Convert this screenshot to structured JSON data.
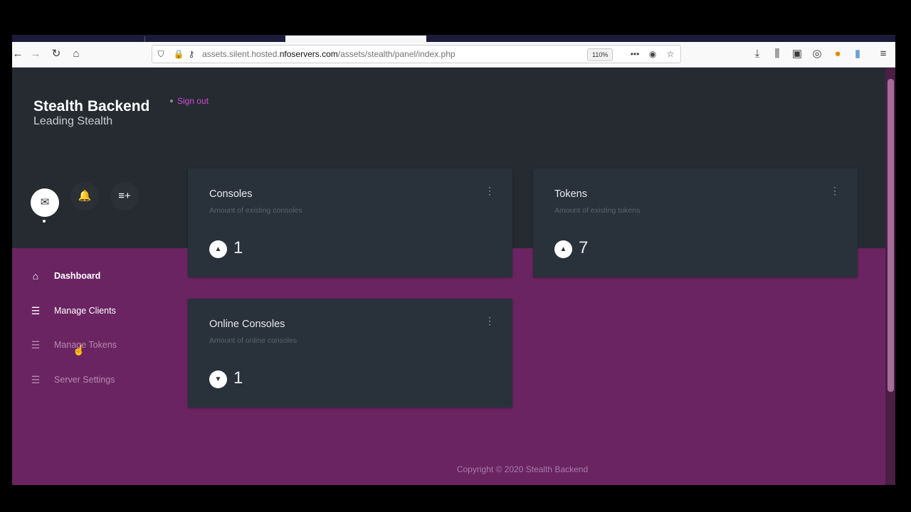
{
  "browser": {
    "url_prefix": "assets.silent.hosted.",
    "url_host": "nfoservers.com",
    "url_path": "/assets/stealth/panel/index.php",
    "zoom": "110%"
  },
  "header": {
    "title": "Stealth Backend",
    "subtitle": "Leading Stealth",
    "signout": "Sign out"
  },
  "nav": {
    "items": [
      {
        "label": "Dashboard"
      },
      {
        "label": "Manage Clients"
      },
      {
        "label": "Manage Tokens"
      },
      {
        "label": "Server Settings"
      }
    ]
  },
  "cards": [
    {
      "title": "Consoles",
      "subtitle": "Amount of existing consoles",
      "value": "1"
    },
    {
      "title": "Tokens",
      "subtitle": "Amount of existing tokens",
      "value": "7"
    },
    {
      "title": "Online Consoles",
      "subtitle": "Amount of online consoles",
      "value": "1"
    }
  ],
  "footer": {
    "copyright": "Copyright © 2020 Stealth Backend"
  },
  "colors": {
    "page_bg": "#6b2462",
    "header_bg": "#252b31",
    "card_bg": "#29313a",
    "accent_link": "#d04bd6"
  }
}
